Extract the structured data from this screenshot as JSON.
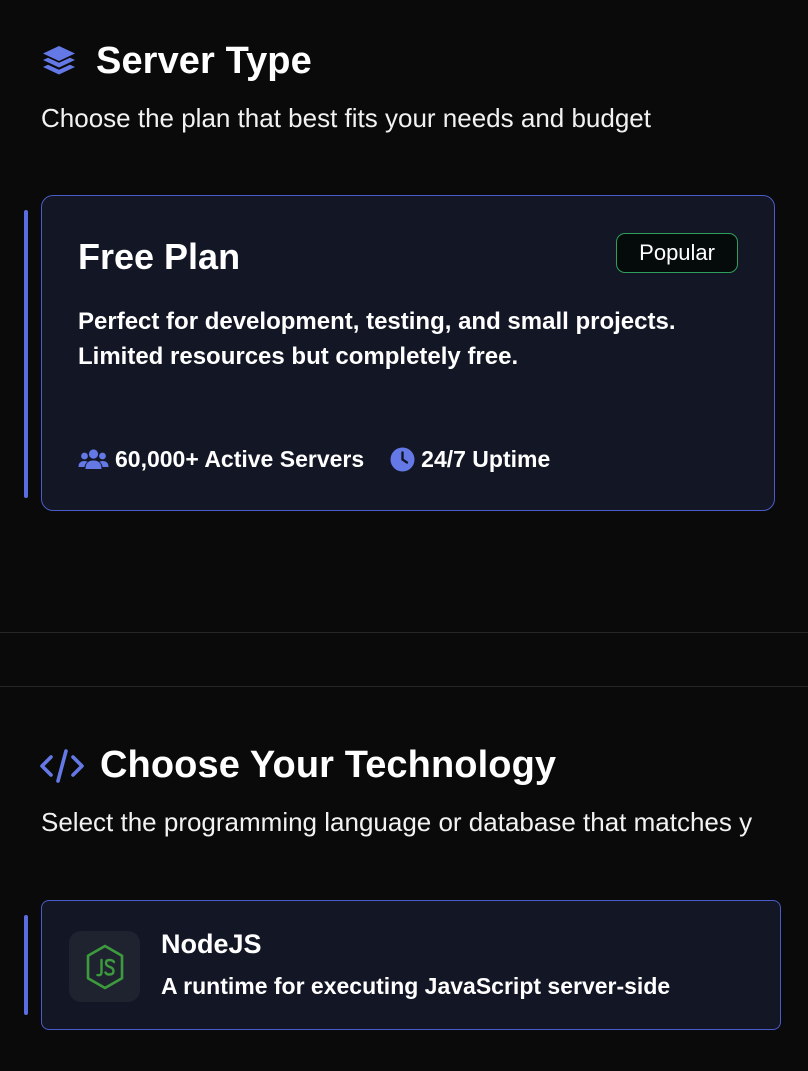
{
  "server_type": {
    "title": "Server Type",
    "subtitle": "Choose the plan that best fits your needs and budget",
    "icon": "layers-icon",
    "plan": {
      "name": "Free Plan",
      "badge": "Popular",
      "description": "Perfect for development, testing, and small projects. Limited resources but completely free.",
      "stats": [
        {
          "icon": "users-icon",
          "label": "60,000+ Active Servers"
        },
        {
          "icon": "clock-icon",
          "label": "24/7 Uptime"
        }
      ]
    }
  },
  "technology": {
    "title": "Choose Your Technology",
    "subtitle": "Select the programming language or database that matches y",
    "icon": "code-icon",
    "option": {
      "name": "NodeJS",
      "description": "A runtime for executing JavaScript server-side",
      "icon": "nodejs-icon"
    }
  },
  "colors": {
    "background": "#0a0a0a",
    "card": "#131624",
    "accent": "#5b6ee1",
    "badge_border": "#2f9e5c",
    "node_green": "#3c9b3c"
  }
}
